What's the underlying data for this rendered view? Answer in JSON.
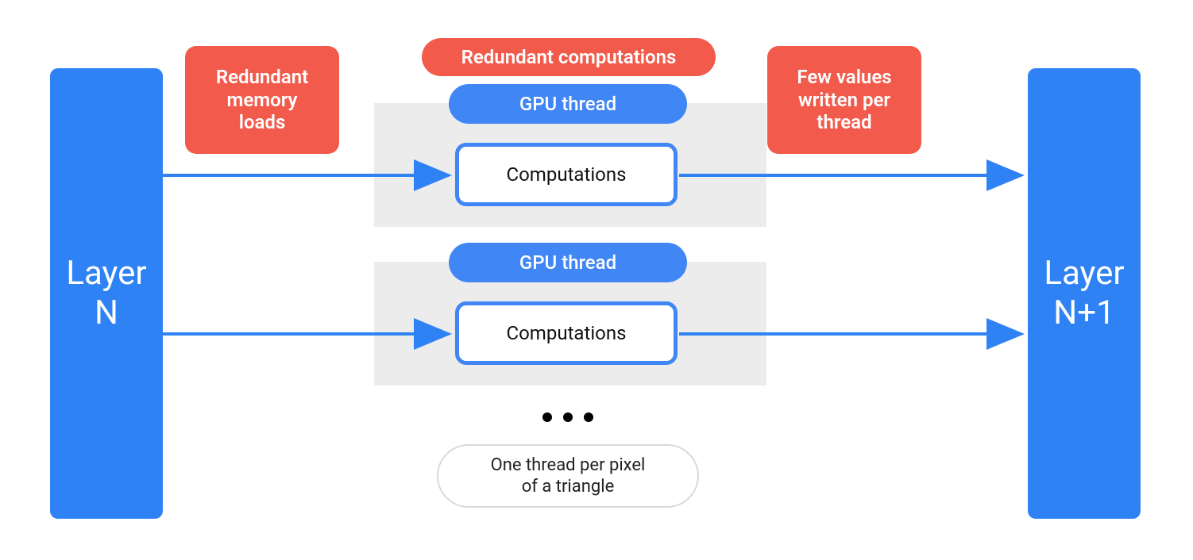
{
  "colors": {
    "blue": "#2f82f4",
    "red": "#f25b4c",
    "pill_blue": "#4186f5",
    "gray_bg": "#ececec",
    "white": "#ffffff",
    "border_gray": "#d9d9d9"
  },
  "layer_left": {
    "label": "Layer\nN"
  },
  "layer_right": {
    "label": "Layer\nN+1"
  },
  "callouts": {
    "redundant_memory_loads": "Redundant\nmemory\nloads",
    "redundant_computations": "Redundant computations",
    "few_values": "Few values\nwritten per\nthread"
  },
  "gpu_threads": [
    {
      "pill_label": "GPU thread",
      "comp_label": "Computations"
    },
    {
      "pill_label": "GPU thread",
      "comp_label": "Computations"
    }
  ],
  "footer_pill": "One thread per pixel\nof a triangle",
  "ellipsis_dots": 3,
  "arrows": [
    {
      "from": "layer_left",
      "to": "gpu_thread_0"
    },
    {
      "from": "gpu_thread_0",
      "to": "layer_right"
    },
    {
      "from": "layer_left",
      "to": "gpu_thread_1"
    },
    {
      "from": "gpu_thread_1",
      "to": "layer_right"
    }
  ]
}
